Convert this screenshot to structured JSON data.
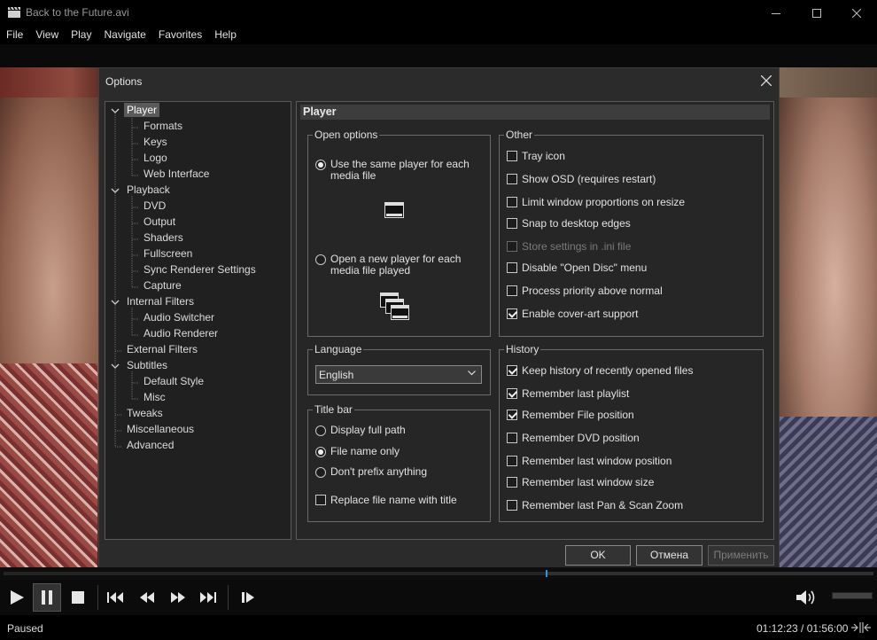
{
  "window": {
    "title": "Back to the Future.avi"
  },
  "menu": [
    "File",
    "View",
    "Play",
    "Navigate",
    "Favorites",
    "Help"
  ],
  "dialog": {
    "title": "Options",
    "tree": [
      {
        "label": "Player",
        "level": 0,
        "expanded": true,
        "selected": true
      },
      {
        "label": "Formats",
        "level": 1
      },
      {
        "label": "Keys",
        "level": 1
      },
      {
        "label": "Logo",
        "level": 1
      },
      {
        "label": "Web Interface",
        "level": 1
      },
      {
        "label": "Playback",
        "level": 0,
        "expanded": true
      },
      {
        "label": "DVD",
        "level": 1
      },
      {
        "label": "Output",
        "level": 1
      },
      {
        "label": "Shaders",
        "level": 1
      },
      {
        "label": "Fullscreen",
        "level": 1
      },
      {
        "label": "Sync Renderer Settings",
        "level": 1
      },
      {
        "label": "Capture",
        "level": 1
      },
      {
        "label": "Internal Filters",
        "level": 0,
        "expanded": true
      },
      {
        "label": "Audio Switcher",
        "level": 1
      },
      {
        "label": "Audio Renderer",
        "level": 1
      },
      {
        "label": "External Filters",
        "level": 0
      },
      {
        "label": "Subtitles",
        "level": 0,
        "expanded": true
      },
      {
        "label": "Default Style",
        "level": 1
      },
      {
        "label": "Misc",
        "level": 1
      },
      {
        "label": "Tweaks",
        "level": 0
      },
      {
        "label": "Miscellaneous",
        "level": 0
      },
      {
        "label": "Advanced",
        "level": 0
      }
    ],
    "panel_title": "Player",
    "open_options": {
      "title": "Open options",
      "same_player": "Use the same player for each media file",
      "new_player": "Open a new player for each media file played",
      "selected": "same_player"
    },
    "language": {
      "title": "Language",
      "value": "English"
    },
    "title_bar": {
      "title": "Title bar",
      "full_path": "Display full path",
      "file_name_only": "File name only",
      "no_prefix": "Don't prefix anything",
      "selected": "file_name_only",
      "replace_title": "Replace file name with title",
      "replace_title_checked": false
    },
    "other": {
      "title": "Other",
      "items": [
        {
          "label": "Tray icon",
          "checked": false
        },
        {
          "label": "Show OSD (requires restart)",
          "checked": false
        },
        {
          "label": "Limit window proportions on resize",
          "checked": false
        },
        {
          "label": "Snap to desktop edges",
          "checked": false
        },
        {
          "label": "Store settings in .ini file",
          "checked": false,
          "disabled": true
        },
        {
          "label": "Disable \"Open Disc\" menu",
          "checked": false
        },
        {
          "label": "Process priority above normal",
          "checked": false
        },
        {
          "label": "Enable cover-art support",
          "checked": true
        }
      ]
    },
    "history": {
      "title": "History",
      "items": [
        {
          "label": "Keep history of recently opened files",
          "checked": true
        },
        {
          "label": "Remember last playlist",
          "checked": true
        },
        {
          "label": "Remember File position",
          "checked": true
        },
        {
          "label": "Remember DVD position",
          "checked": false
        },
        {
          "label": "Remember last window position",
          "checked": false
        },
        {
          "label": "Remember last window size",
          "checked": false
        },
        {
          "label": "Remember last Pan & Scan Zoom",
          "checked": false
        }
      ]
    },
    "buttons": {
      "ok": "OK",
      "cancel": "Отмена",
      "apply": "Применить"
    }
  },
  "playback": {
    "progress": 0.624
  },
  "status": {
    "state": "Paused",
    "time": "01:12:23 / 01:56:00"
  }
}
